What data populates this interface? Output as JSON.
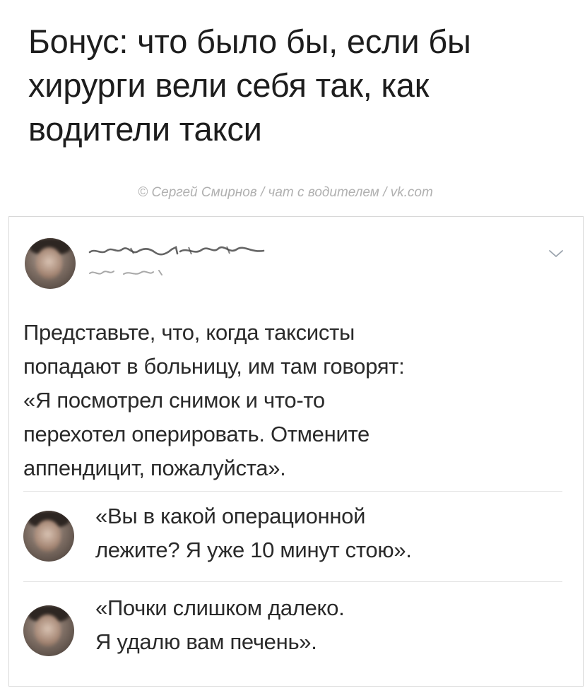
{
  "header": {
    "title_lines": [
      "Бонус: что было бы, если бы",
      "хирурги вели себя так, как",
      "водители такси"
    ],
    "credit": "© Сергей Смирнов / чат с водителем / vk.com"
  },
  "post": {
    "avatar": "user-avatar",
    "chevron": "chevron-down-icon",
    "text_lines": [
      "Представьте, что, когда таксисты",
      "попадают в больницу, им там говорят:",
      "«Я посмотрел снимок и что-то",
      "перехотел оперировать. Отмените",
      "аппендицит, пожалуйста»."
    ]
  },
  "comments": [
    {
      "avatar": "user-avatar",
      "text_lines": [
        "«Вы в какой операционной",
        "лежите? Я уже 10 минут стою»."
      ]
    },
    {
      "avatar": "user-avatar",
      "text_lines": [
        "«Почки слишком далеко.",
        "Я удалю вам печень»."
      ]
    }
  ],
  "colors": {
    "text": "#2a2a2a",
    "credit": "#b0b0b0",
    "border": "#d8d8d8",
    "divider": "#e3e3e3"
  }
}
